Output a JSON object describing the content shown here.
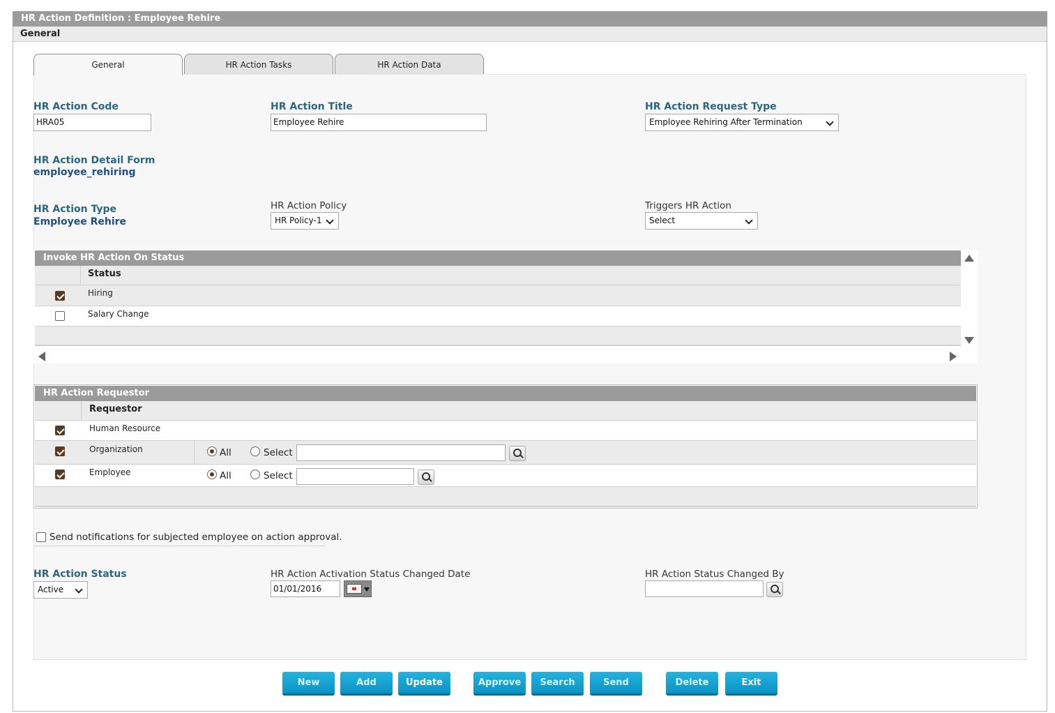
{
  "window": {
    "title": "HR Action Definition :  Employee Rehire",
    "section": "General"
  },
  "tabs": [
    {
      "label": "General",
      "active": true
    },
    {
      "label": "HR Action Tasks",
      "active": false
    },
    {
      "label": "HR Action Data",
      "active": false
    }
  ],
  "form": {
    "code_label": "HR Action Code",
    "code_value": "HRA05",
    "title_label": "HR Action Title",
    "title_value": "Employee Rehire",
    "request_type_label": "HR Action Request Type",
    "request_type_value": "Employee Rehiring After Termination",
    "detail_form_label": "HR Action Detail Form",
    "detail_form_value": "employee_rehiring",
    "type_label": "HR Action Type",
    "type_value": "Employee Rehire",
    "policy_label": "HR Action Policy",
    "policy_value": "HR Policy-1",
    "triggers_label": "Triggers HR Action",
    "triggers_value": "Select"
  },
  "status_grid": {
    "title": "Invoke HR Action On Status",
    "column": "Status",
    "rows": [
      {
        "label": "Hiring",
        "checked": true
      },
      {
        "label": "Salary Change",
        "checked": false
      }
    ]
  },
  "requestor_grid": {
    "title": "HR Action Requestor",
    "column": "Requestor",
    "rows": [
      {
        "label": "Human Resource",
        "checked": true
      },
      {
        "label": "Organization",
        "checked": true,
        "radio_all": "All",
        "radio_select": "Select",
        "selected": "All"
      },
      {
        "label": "Employee",
        "checked": true,
        "radio_all": "All",
        "radio_select": "Select",
        "selected": "All"
      }
    ]
  },
  "notify": {
    "label": "Send notifications for subjected employee on action approval.",
    "checked": false
  },
  "status_section": {
    "status_label": "HR Action Status",
    "status_value": "Active",
    "date_label": "HR Action Activation Status Changed Date",
    "date_value": "01/01/2016",
    "changed_by_label": "HR Action Status Changed By",
    "changed_by_value": ""
  },
  "buttons": {
    "new": "New",
    "add": "Add",
    "update": "Update",
    "approve": "Approve",
    "search": "Search",
    "send": "Send",
    "delete": "Delete",
    "exit": "Exit"
  },
  "colors": {
    "header_gray": "#9b9b9b",
    "label_blue": "#2d6680",
    "value_blue": "#1c4f86",
    "button_blue": "#1aa6d6",
    "checkbox_brown": "#5a3b1f"
  }
}
